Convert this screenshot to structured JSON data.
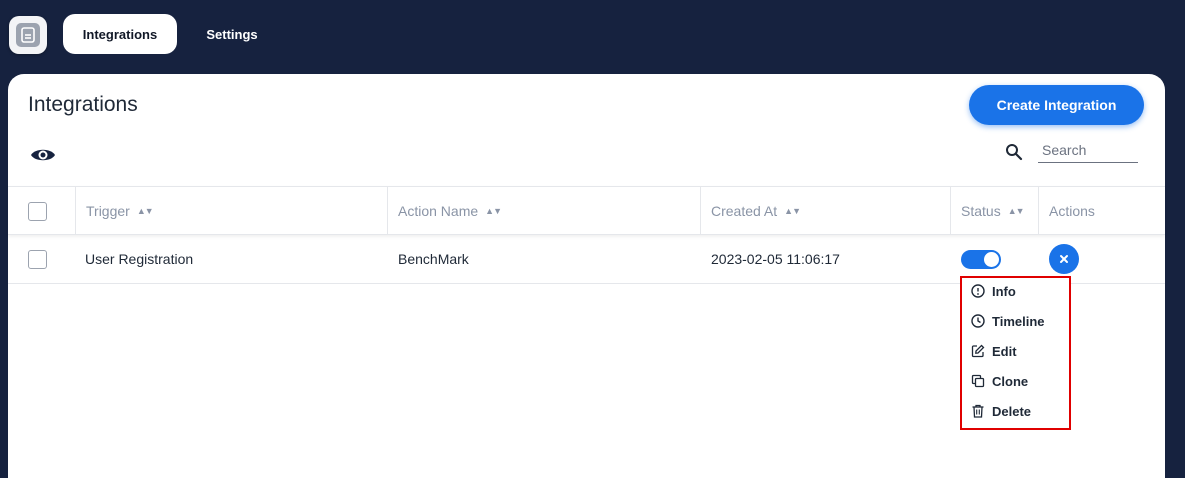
{
  "nav": {
    "tabs": [
      {
        "label": "Integrations",
        "active": true
      },
      {
        "label": "Settings",
        "active": false
      }
    ]
  },
  "page": {
    "title": "Integrations",
    "create_button": "Create Integration",
    "search_placeholder": "Search"
  },
  "table": {
    "columns": [
      "Trigger",
      "Action Name",
      "Created At",
      "Status",
      "Actions"
    ],
    "rows": [
      {
        "trigger": "User Registration",
        "action_name": "BenchMark",
        "created_at": "2023-02-05 11:06:17",
        "status_enabled": true
      }
    ]
  },
  "action_menu": {
    "items": [
      {
        "label": "Info",
        "icon": "info-icon"
      },
      {
        "label": "Timeline",
        "icon": "clock-icon"
      },
      {
        "label": "Edit",
        "icon": "edit-icon"
      },
      {
        "label": "Clone",
        "icon": "clone-icon"
      },
      {
        "label": "Delete",
        "icon": "trash-icon"
      }
    ]
  },
  "colors": {
    "header_bg": "#16223f",
    "accent": "#1a73e8",
    "highlight_border": "#e00000"
  }
}
